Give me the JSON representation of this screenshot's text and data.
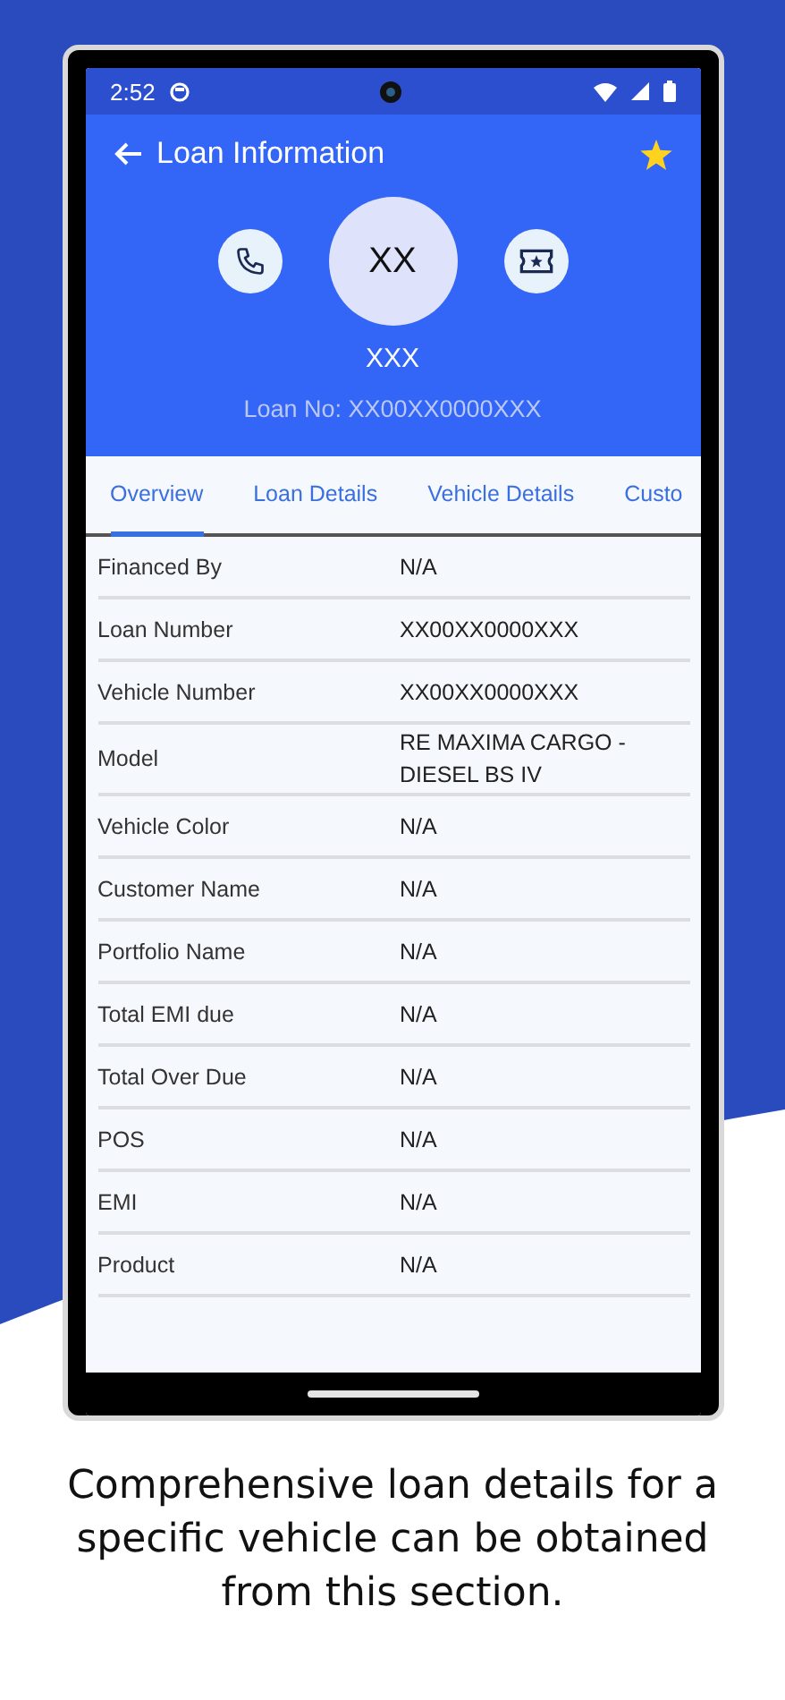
{
  "status_bar": {
    "time": "2:52"
  },
  "header": {
    "title": "Loan Information",
    "avatar_initials": "XX",
    "name": "XXX",
    "loan_no": "Loan No: XX00XX0000XXX"
  },
  "tabs": [
    {
      "label": "Overview",
      "selected": true
    },
    {
      "label": "Loan Details",
      "selected": false
    },
    {
      "label": "Vehicle Details",
      "selected": false
    },
    {
      "label": "Custo",
      "selected": false
    }
  ],
  "rows": [
    {
      "label": "Financed By",
      "value": "N/A"
    },
    {
      "label": "Loan Number",
      "value": "XX00XX0000XXX"
    },
    {
      "label": "Vehicle Number",
      "value": "XX00XX0000XXX"
    },
    {
      "label": "Model",
      "value": "RE MAXIMA CARGO -DIESEL BS IV"
    },
    {
      "label": "Vehicle Color",
      "value": "N/A"
    },
    {
      "label": "Customer Name",
      "value": "N/A"
    },
    {
      "label": "Portfolio Name",
      "value": "N/A"
    },
    {
      "label": "Total EMI due",
      "value": "N/A"
    },
    {
      "label": "Total Over Due",
      "value": "N/A"
    },
    {
      "label": "POS",
      "value": "N/A"
    },
    {
      "label": "EMI",
      "value": "N/A"
    },
    {
      "label": "Product",
      "value": "N/A"
    }
  ],
  "caption": "Comprehensive loan details for a specific vehicle can be obtained from this section."
}
